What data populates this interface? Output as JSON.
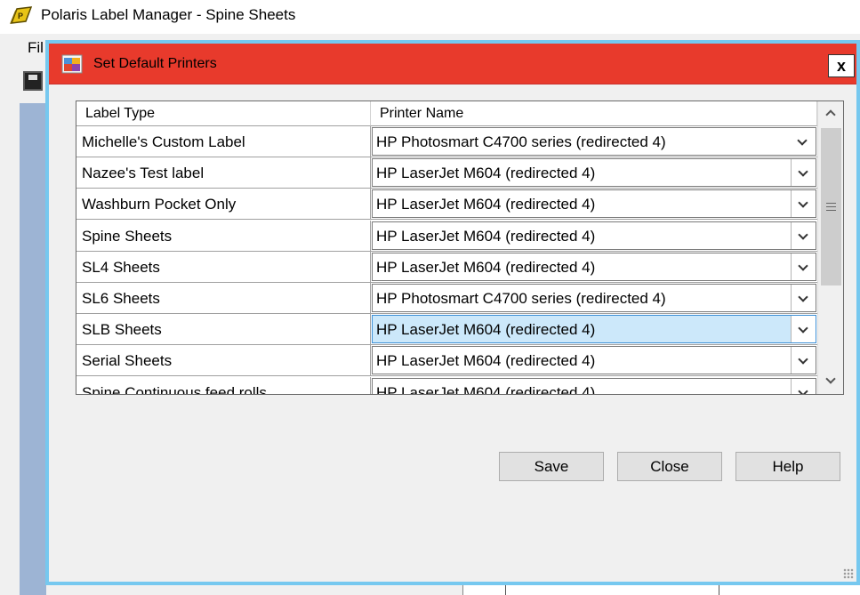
{
  "app": {
    "title": "Polaris Label Manager - Spine Sheets",
    "menu_file": "Fil"
  },
  "dialog": {
    "title": "Set Default Printers",
    "close_symbol": "x"
  },
  "grid": {
    "columns": [
      "Label Type",
      "Printer Name"
    ],
    "rows": [
      {
        "label": "Michelle's Custom Label",
        "printer": "HP Photosmart C4700 series (redirected 4)"
      },
      {
        "label": "Nazee's Test label",
        "printer": "HP LaserJet M604 (redirected 4)"
      },
      {
        "label": "Washburn Pocket Only",
        "printer": "HP LaserJet M604 (redirected 4)"
      },
      {
        "label": "Spine Sheets",
        "printer": "HP LaserJet M604 (redirected 4)"
      },
      {
        "label": "SL4 Sheets",
        "printer": "HP LaserJet M604 (redirected 4)"
      },
      {
        "label": "SL6 Sheets",
        "printer": "HP Photosmart C4700 series (redirected 4)"
      },
      {
        "label": "SLB Sheets",
        "printer": "HP LaserJet M604 (redirected 4)"
      },
      {
        "label": "Serial Sheets",
        "printer": "HP LaserJet M604 (redirected 4)"
      },
      {
        "label": "Spine Continuous feed rolls",
        "printer": "HP LaserJet M604 (redirected 4)"
      }
    ],
    "selected_row": 6
  },
  "buttons": {
    "save": "Save",
    "close": "Close",
    "help": "Help"
  },
  "colors": {
    "dialog_titlebar": "#e83a2c",
    "dialog_border": "#76c8ef",
    "selection": "#cce8fa"
  }
}
